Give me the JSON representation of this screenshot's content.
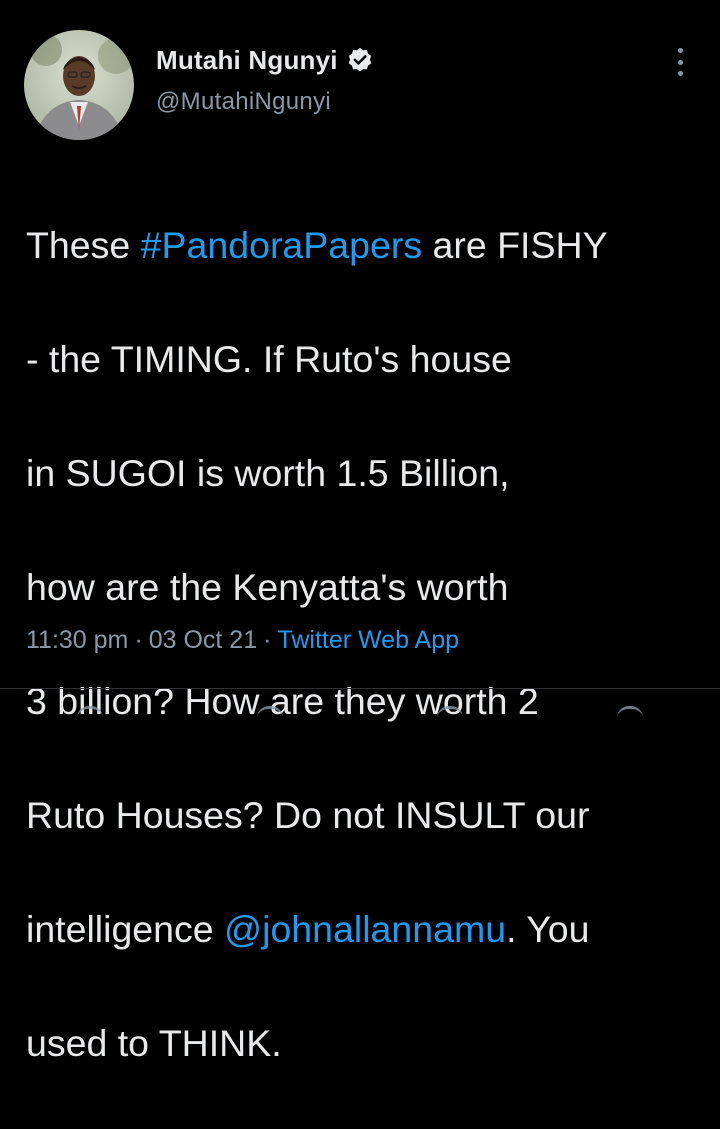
{
  "author": {
    "display_name": "Mutahi Ngunyi",
    "handle": "@MutahiNgunyi",
    "verified": true,
    "avatar_icon": "profile-photo"
  },
  "tweet": {
    "lines": [
      {
        "pre": "These ",
        "link": "#PandoraPapers",
        "post": " are FISHY"
      },
      {
        "pre": "- the TIMING. If Ruto's house",
        "link": "",
        "post": ""
      },
      {
        "pre": "in SUGOI is worth 1.5 Billion,",
        "link": "",
        "post": ""
      },
      {
        "pre": "how are the Kenyatta's worth",
        "link": "",
        "post": ""
      },
      {
        "pre": "3 billion? How are they worth 2",
        "link": "",
        "post": ""
      },
      {
        "pre": "Ruto Houses? Do not INSULT our",
        "link": "",
        "post": ""
      },
      {
        "pre": "intelligence ",
        "link": "@johnallannamu",
        "post": ". You"
      },
      {
        "pre": "used to THINK.",
        "link": "",
        "post": ""
      }
    ]
  },
  "meta": {
    "time": "11:30 pm",
    "date": "03 Oct 21",
    "separator": "·",
    "source": "Twitter Web App"
  },
  "icons": {
    "more": "more-options-icon",
    "verified": "verified-badge-icon"
  },
  "colors": {
    "background": "#000000",
    "text": "#e7e9ea",
    "secondary": "#8b98a5",
    "link": "#1d9bf0"
  }
}
